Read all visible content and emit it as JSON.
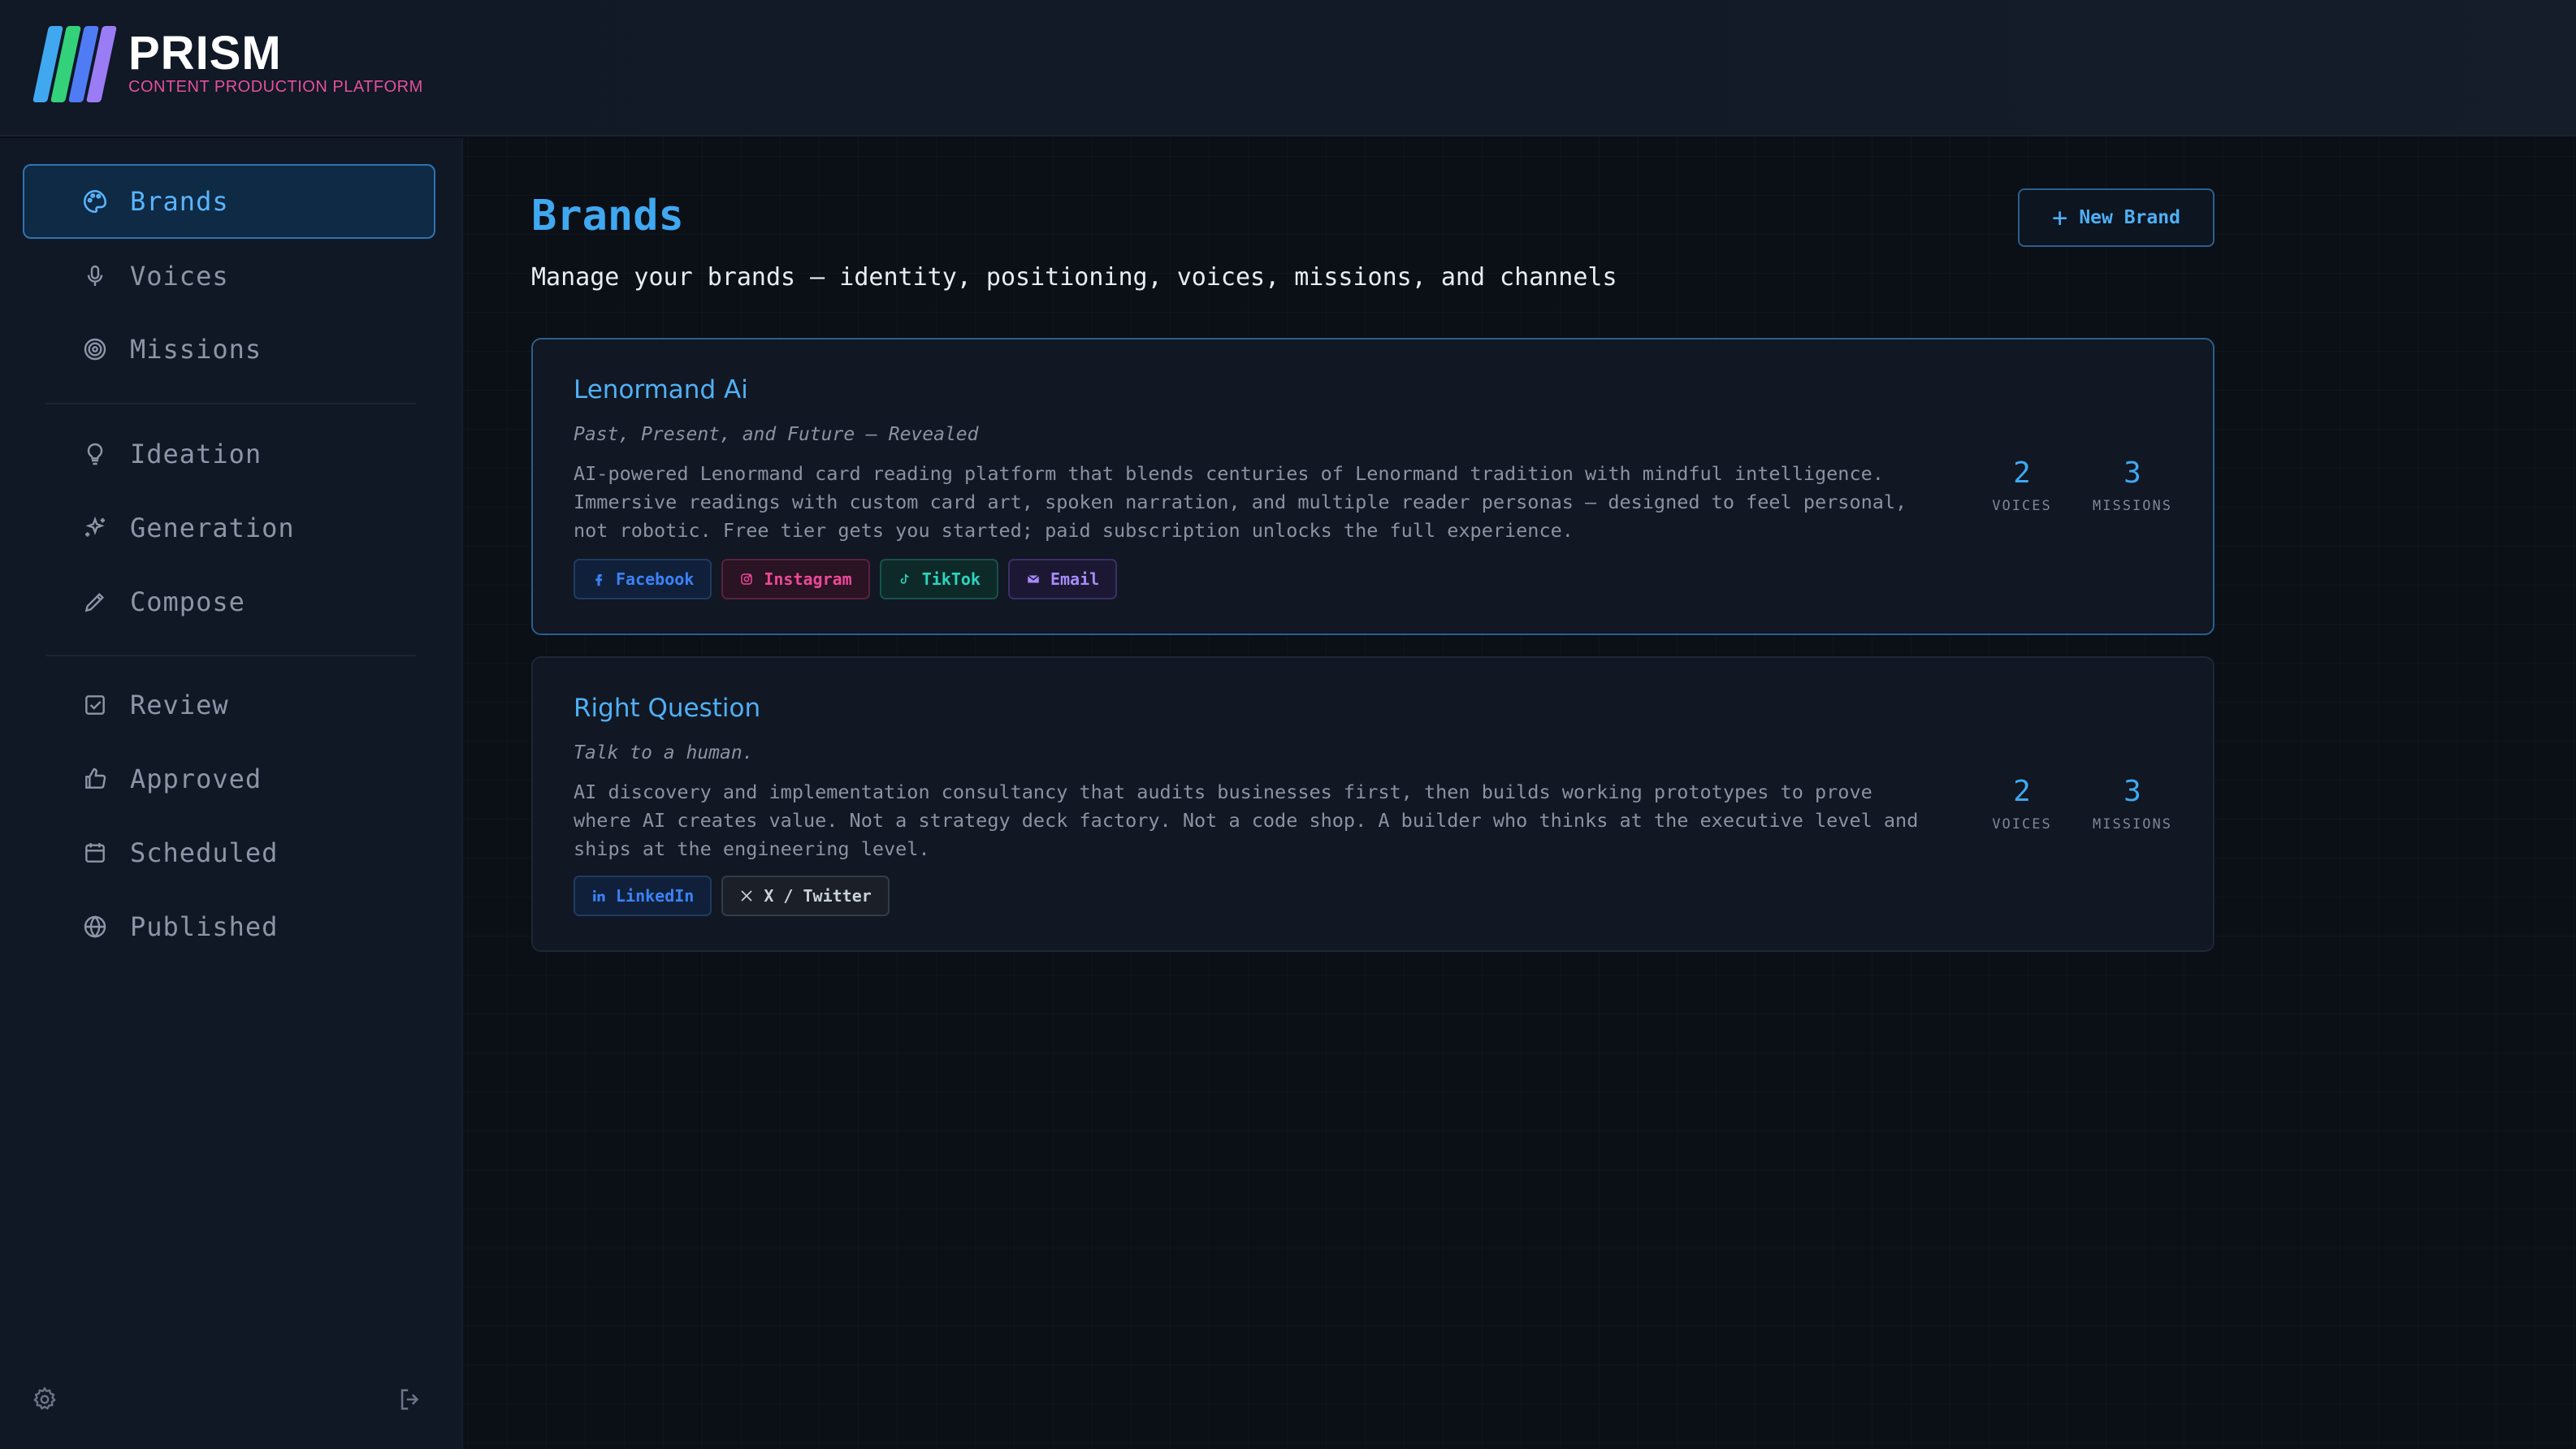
{
  "app": {
    "name": "PRISM",
    "subtitle": "CONTENT PRODUCTION PLATFORM",
    "logo_colors": [
      "#3fa8f0",
      "#33d17a",
      "#4f7cf5",
      "#9a7cf5"
    ]
  },
  "sidebar": {
    "items": [
      {
        "label": "Brands",
        "icon": "palette-icon",
        "active": true
      },
      {
        "label": "Voices",
        "icon": "microphone-icon"
      },
      {
        "label": "Missions",
        "icon": "target-icon"
      },
      {
        "label": "Ideation",
        "icon": "lightbulb-icon"
      },
      {
        "label": "Generation",
        "icon": "sparkles-icon"
      },
      {
        "label": "Compose",
        "icon": "pen-icon"
      },
      {
        "label": "Review",
        "icon": "checkbox-icon"
      },
      {
        "label": "Approved",
        "icon": "thumbs-up-icon"
      },
      {
        "label": "Scheduled",
        "icon": "calendar-icon"
      },
      {
        "label": "Published",
        "icon": "globe-icon"
      }
    ],
    "footer": {
      "settings_icon": "gear-icon",
      "logout_icon": "logout-icon"
    }
  },
  "main": {
    "title": "Brands",
    "description": "Manage your brands — identity, positioning, voices, missions, and channels",
    "new_button": "New Brand",
    "brands": [
      {
        "name": "Lenormand Ai",
        "tagline": "Past, Present, and Future — Revealed",
        "description": "AI-powered Lenormand card reading platform that blends centuries of Lenormand tradition with mindful intelligence. Immersive readings with custom card art, spoken narration, and multiple reader personas — designed to feel personal, not robotic. Free tier gets you started; paid subscription unlocks the full experience.",
        "voices": "2",
        "voices_label": "VOICES",
        "missions": "3",
        "missions_label": "MISSIONS",
        "channels": [
          {
            "label": "Facebook",
            "icon": "facebook-icon",
            "color": "#3b82f6"
          },
          {
            "label": "Instagram",
            "icon": "instagram-icon",
            "color": "#ec4899"
          },
          {
            "label": "TikTok",
            "icon": "tiktok-icon",
            "color": "#2dd4bf"
          },
          {
            "label": "Email",
            "icon": "mail-icon",
            "color": "#a78bfa"
          }
        ]
      },
      {
        "name": "Right Question",
        "tagline": "Talk to a human.",
        "description": "AI discovery and implementation consultancy that audits businesses first, then builds working prototypes to prove where AI creates value. Not a strategy deck factory. Not a code shop. A builder who thinks at the executive level and ships at the engineering level.",
        "voices": "2",
        "voices_label": "VOICES",
        "missions": "3",
        "missions_label": "MISSIONS",
        "channels": [
          {
            "label": "LinkedIn",
            "icon": "linkedin-icon",
            "color": "#3b82f6"
          },
          {
            "label": "X / Twitter",
            "icon": "x-icon",
            "color": "#c9d1d9"
          }
        ]
      }
    ]
  }
}
